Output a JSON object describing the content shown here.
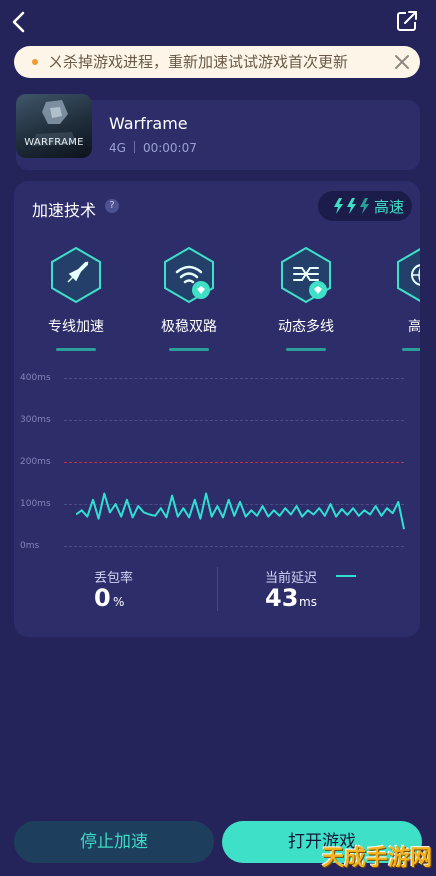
{
  "notice": {
    "text": "ㄨ杀掉游戏进程，重新加速试试游戏首次更新"
  },
  "game": {
    "name": "Warframe",
    "logo_text": "WARFRAME",
    "network": "4G",
    "duration": "00:00:07"
  },
  "tech": {
    "title": "加速技术",
    "mode_label": "高速",
    "items": [
      {
        "label": "专线加速",
        "icon": "rocket-icon"
      },
      {
        "label": "极稳双路",
        "icon": "wifi-dual-icon"
      },
      {
        "label": "动态多线",
        "icon": "multi-line-icon"
      },
      {
        "label": "高速",
        "icon": "globe-icon"
      }
    ]
  },
  "chart_data": {
    "type": "line",
    "yticks": [
      "400ms",
      "300ms",
      "200ms",
      "100ms",
      "0ms"
    ],
    "threshold": 200,
    "ylim": [
      0,
      400
    ],
    "series": [
      {
        "values": [
          75,
          85,
          70,
          110,
          65,
          125,
          80,
          100,
          70,
          110,
          68,
          95,
          80,
          75,
          72,
          90,
          68,
          120,
          70,
          90,
          68,
          110,
          65,
          125,
          70,
          95,
          68,
          110,
          72,
          105,
          70,
          85,
          72,
          95,
          70,
          85,
          72,
          90,
          75,
          95,
          70,
          85,
          75,
          90,
          72,
          100,
          70,
          88,
          74,
          90,
          72,
          85,
          75,
          95,
          72,
          90,
          78,
          105,
          40
        ]
      }
    ],
    "color": "#2fe0d2"
  },
  "stats": {
    "loss_label": "丢包率",
    "loss_value": "0",
    "loss_unit": "%",
    "latency_label": "当前延迟",
    "latency_value": "43",
    "latency_unit": "ms"
  },
  "buttons": {
    "stop": "停止加速",
    "open": "打开游戏"
  },
  "watermark": "天成手游网"
}
